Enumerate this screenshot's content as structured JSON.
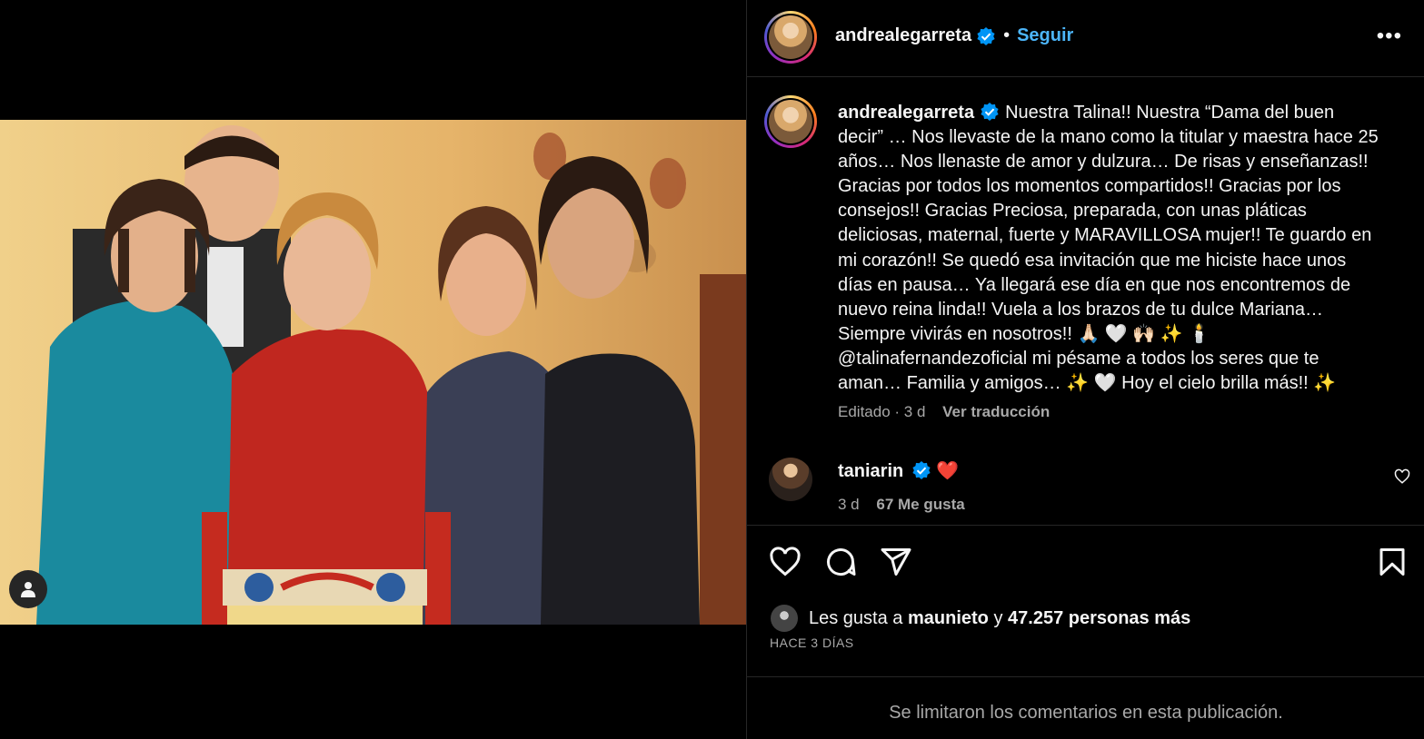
{
  "post": {
    "image_alt": "Grupo de cinco personas posando frente a una silla",
    "author": {
      "username": "andrealegarreta",
      "verified": true,
      "follow_label": "Seguir",
      "separator": "•"
    },
    "more_icon": "•••",
    "caption": {
      "username": "andrealegarreta",
      "text": "Nuestra Talina!! Nuestra “Dama del buen decir” … Nos llevaste de la mano como la titular y maestra hace 25 años… Nos llenaste de amor y dulzura… De risas y enseñanzas!! Gracias por todos los momentos compartidos!! Gracias por los consejos!! Gracias Preciosa, preparada, con unas pláticas deliciosas, maternal, fuerte y MARAVILLOSA mujer!! Te guardo en mi corazón!! Se quedó esa invitación que me hiciste hace unos días en pausa… Ya llegará ese día en que nos encontremos de nuevo reina linda!! Vuela a los brazos de tu dulce Mariana… Siempre vivirás en nosotros!! 🙏🏻 🤍 🙌🏻 ✨  🕯️ @talinafernandezoficial mi pésame a todos los seres que te aman… Familia y amigos… ✨ 🤍  Hoy el cielo brilla más!! ✨",
      "edited": "Editado · 3 d",
      "translate_label": "Ver traducción"
    },
    "comment": {
      "username": "taniarin",
      "verified": true,
      "text": "❤️",
      "time": "3 d",
      "likes": "67 Me gusta"
    },
    "likes": {
      "prefix": "Les gusta a",
      "user": "maunieto",
      "conj": "y",
      "count": "47.257 personas más"
    },
    "date": "HACE 3 DÍAS",
    "comments_limited": "Se limitaron los comentarios en esta publicación."
  },
  "colors": {
    "accent": "#4cb5f9",
    "verified": "#0095f6",
    "background": "#000000",
    "secondary_text": "#a8a8a8"
  }
}
